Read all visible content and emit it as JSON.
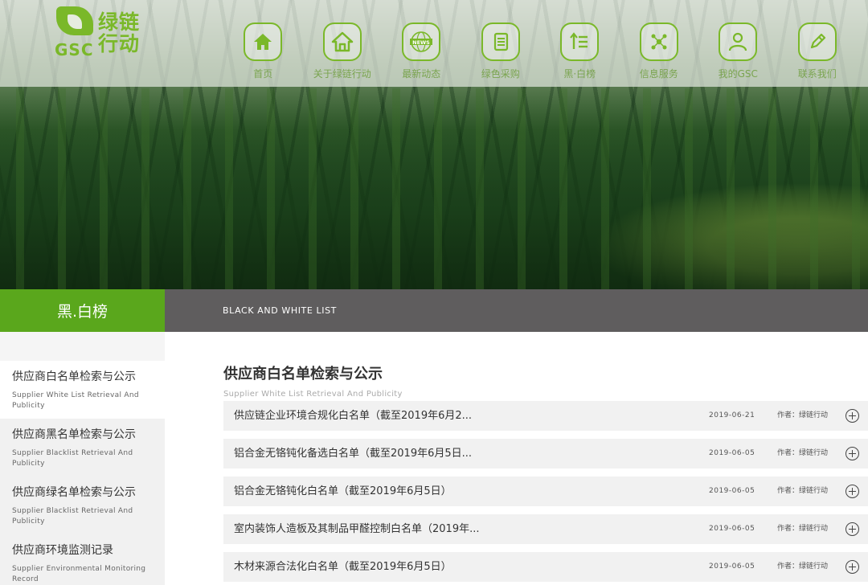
{
  "brand": {
    "logo_en": "GSC",
    "logo_cn": "绿链行动"
  },
  "nav": {
    "items": [
      {
        "label": "首页",
        "icon": "home-icon"
      },
      {
        "label": "关于绿链行动",
        "icon": "house-icon"
      },
      {
        "label": "最新动态",
        "icon": "news-globe-icon"
      },
      {
        "label": "绿色采购",
        "icon": "document-icon"
      },
      {
        "label": "黑·白榜",
        "icon": "list-icon"
      },
      {
        "label": "信息服务",
        "icon": "network-icon"
      },
      {
        "label": "我的GSC",
        "icon": "user-icon"
      },
      {
        "label": "联系我们",
        "icon": "pencil-icon"
      }
    ],
    "news_text": "NEWS"
  },
  "section": {
    "title_cn": "黑.白榜",
    "title_en": "BLACK AND WHITE LIST"
  },
  "sidebar": {
    "items": [
      {
        "title": "供应商白名单检索与公示",
        "subtitle": "Supplier White List Retrieval And Publicity"
      },
      {
        "title": "供应商黑名单检索与公示",
        "subtitle": "Supplier Blacklist Retrieval And Publicity"
      },
      {
        "title": "供应商绿名单检索与公示",
        "subtitle": "Supplier Blacklist Retrieval And Publicity"
      },
      {
        "title": "供应商环境监测记录",
        "subtitle": "Supplier Environmental Monitoring Record"
      }
    ]
  },
  "main": {
    "title": "供应商白名单检索与公示",
    "subtitle": "Supplier White List Retrieval And Publicity",
    "rows": [
      {
        "title": "供应链企业环境合规化白名单（截至2019年6月2...",
        "date": "2019-06-21",
        "author": "作者：绿链行动"
      },
      {
        "title": "铝合金无铬钝化备选白名单（截至2019年6月5日...",
        "date": "2019-06-05",
        "author": "作者：绿链行动"
      },
      {
        "title": "铝合金无铬钝化白名单（截至2019年6月5日）",
        "date": "2019-06-05",
        "author": "作者：绿链行动"
      },
      {
        "title": "室内装饰人造板及其制品甲醛控制白名单（2019年...",
        "date": "2019-06-05",
        "author": "作者：绿链行动"
      },
      {
        "title": "木材来源合法化白名单（截至2019年6月5日）",
        "date": "2019-06-05",
        "author": "作者：绿链行动"
      }
    ]
  },
  "colors": {
    "brand_green": "#7ab829",
    "section_green": "#5aa71c",
    "section_gray": "#5f5d5e"
  }
}
